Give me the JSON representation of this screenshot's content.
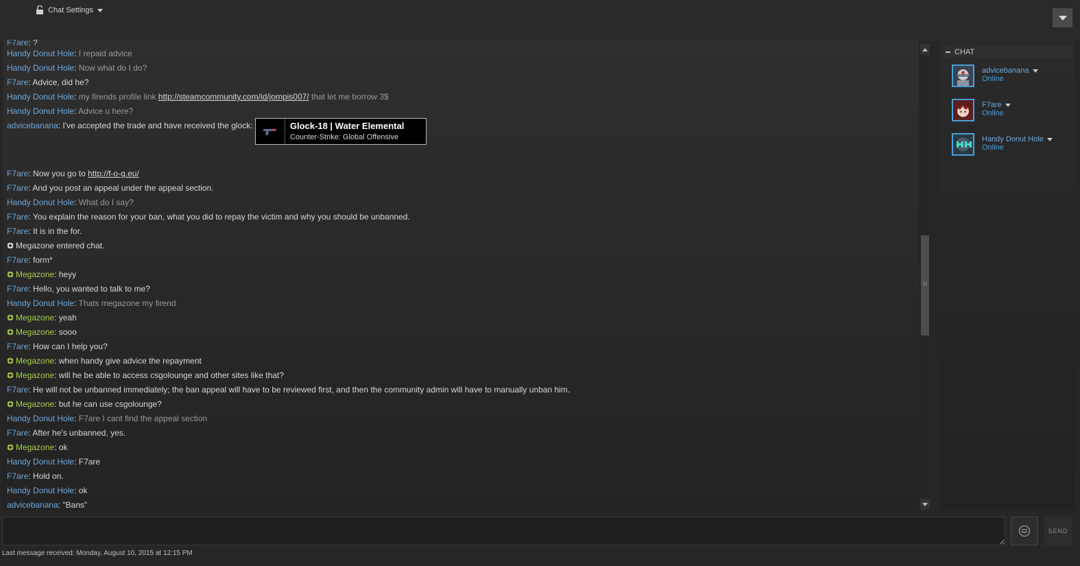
{
  "header": {
    "chat_settings_label": "Chat Settings"
  },
  "messages": [
    {
      "speaker": "F7are",
      "text": "?",
      "type": "user"
    },
    {
      "speaker": "Handy Donut Hole",
      "text": "I repaid advice",
      "type": "user",
      "muted": true
    },
    {
      "speaker": "Handy Donut Hole",
      "text": "Now what do I do?",
      "type": "user",
      "muted": true
    },
    {
      "speaker": "F7are",
      "text": "Advice, did he?",
      "type": "user"
    },
    {
      "speaker": "Handy Donut Hole",
      "text": "my firends profile link ",
      "link": "http://steamcommunity.com/id/jompis007/",
      "after": " that let me borrow 3$",
      "type": "user",
      "muted": true
    },
    {
      "speaker": "Handy Donut Hole",
      "text": "Advice u here?",
      "type": "user",
      "muted": true
    },
    {
      "speaker": "advicebanana",
      "text": "I've accepted the trade and have received the glock: ",
      "type": "card"
    },
    {
      "speaker": "F7are",
      "text": "Now you go to ",
      "link": "http://f-o-g.eu/",
      "type": "user"
    },
    {
      "speaker": "F7are",
      "text": "And you post an appeal under the appeal section.",
      "type": "user"
    },
    {
      "speaker": "Handy Donut Hole",
      "text": "What  do I say?",
      "type": "user",
      "muted": true
    },
    {
      "speaker": "F7are",
      "text": "You explain the reason for your ban, what you did to repay the victim and why you should be unbanned.",
      "type": "user"
    },
    {
      "speaker": "F7are",
      "text": "It is in the for.",
      "type": "user"
    },
    {
      "speaker": "",
      "text": "Megazone entered chat.",
      "type": "event"
    },
    {
      "speaker": "F7are",
      "text": "form*",
      "type": "user"
    },
    {
      "speaker": "Megazone",
      "text": "heyy",
      "type": "system"
    },
    {
      "speaker": "F7are",
      "text": "Hello, you wanted to talk to me?",
      "type": "user"
    },
    {
      "speaker": "Handy Donut Hole",
      "text": "Thats megazone my firend",
      "type": "user",
      "muted": true
    },
    {
      "speaker": "Megazone",
      "text": "yeah",
      "type": "system"
    },
    {
      "speaker": "Megazone",
      "text": "sooo",
      "type": "system"
    },
    {
      "speaker": "F7are",
      "text": "How can I help you?",
      "type": "user"
    },
    {
      "speaker": "Megazone",
      "text": "when handy give advice the repayment",
      "type": "system"
    },
    {
      "speaker": "Megazone",
      "text": "will he be able to access csgolounge and other sites like that?",
      "type": "system"
    },
    {
      "speaker": "F7are",
      "text": "He will not be unbanned immediately; the ban appeal will have to be reviewed first, and then the community admin will have to manually unban him.",
      "type": "user"
    },
    {
      "speaker": "Megazone",
      "text": "but he can use csgolounge?",
      "type": "system"
    },
    {
      "speaker": "Handy Donut Hole",
      "text": "F7are I cant find the appeal section",
      "type": "user",
      "muted": true
    },
    {
      "speaker": "F7are",
      "text": "After he's unbanned, yes.",
      "type": "user"
    },
    {
      "speaker": "Megazone",
      "text": "ok",
      "type": "system"
    },
    {
      "speaker": "Handy Donut Hole",
      "text": "F7are",
      "type": "user"
    },
    {
      "speaker": "F7are",
      "text": "Hold on.",
      "type": "user"
    },
    {
      "speaker": "Handy Donut Hole",
      "text": "ok",
      "type": "user"
    },
    {
      "speaker": "advicebanana",
      "text": "\"Bans\"",
      "type": "user"
    }
  ],
  "item_card": {
    "name": "Glock-18 | Water Elemental",
    "game": "Counter-Strike: Global Offensive"
  },
  "members_panel": {
    "title": "CHAT",
    "members": [
      {
        "name": "advicebanana",
        "status": "Online"
      },
      {
        "name": "F7are",
        "status": "Online"
      },
      {
        "name": "Handy Donut Hole",
        "status": "Online"
      }
    ]
  },
  "composer": {
    "input_value": "",
    "send_label": "SEND"
  },
  "footer": {
    "last_message": "Last message received: Monday, August 10, 2015 at 12:15 PM"
  },
  "colors": {
    "speaker": "#6fa8dc",
    "system_speaker": "#a9cf46",
    "status": "#4aa0d8",
    "background": "#262626"
  },
  "icons": {
    "settings": "lock-icon",
    "dropdown": "chevron-down-icon",
    "event": "gear-icon",
    "emoticon": "smiley-icon"
  }
}
